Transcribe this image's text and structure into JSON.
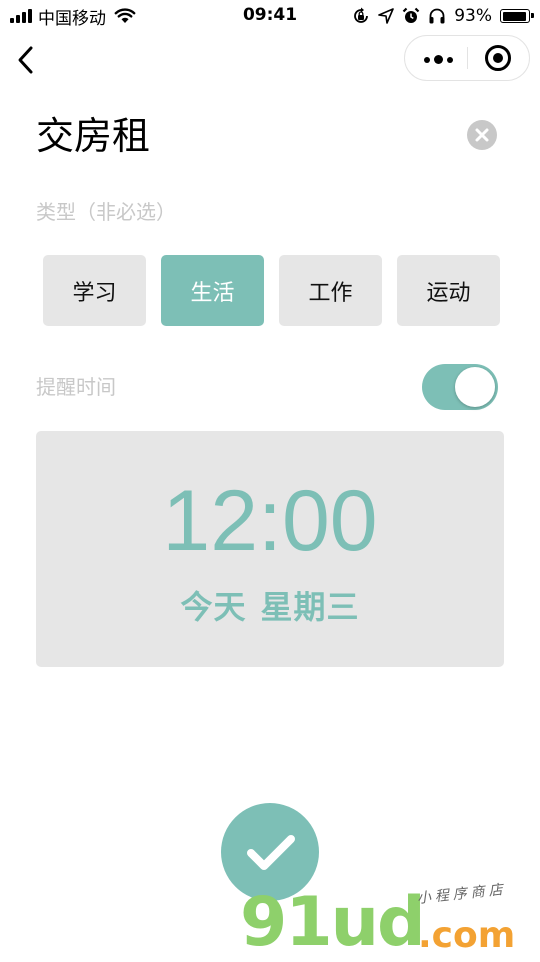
{
  "status_bar": {
    "carrier": "中国移动",
    "time": "09:41",
    "battery_percent": "93%",
    "battery_level": 0.93,
    "icons": [
      "signal-icon",
      "wifi-icon",
      "orientation-lock-icon",
      "location-icon",
      "alarm-icon",
      "headphones-icon",
      "battery-icon"
    ]
  },
  "nav": {
    "back_icon": "chevron-left-icon",
    "capsule": {
      "more_icon": "more-dots-icon",
      "close_icon": "target-close-icon"
    }
  },
  "form": {
    "title": "交房租",
    "clear_icon": "clear-circle-icon",
    "type_label": "类型（非必选）",
    "types": [
      {
        "label": "学习",
        "selected": false
      },
      {
        "label": "生活",
        "selected": true
      },
      {
        "label": "工作",
        "selected": false
      },
      {
        "label": "运动",
        "selected": false
      }
    ],
    "remind_label": "提醒时间",
    "remind_enabled": true,
    "time": "12:00",
    "date_day": "今天",
    "date_weekday": "星期三",
    "confirm_icon": "checkmark-icon"
  },
  "watermark": {
    "logo": "91ud",
    "domain": ".com",
    "tagline": "小程序商店"
  },
  "colors": {
    "accent": "#7dbfb6",
    "chip_bg": "#e6e6e6",
    "muted_text": "#c8c8c8",
    "watermark_green": "#8ed06b",
    "watermark_orange": "#f3a233"
  }
}
